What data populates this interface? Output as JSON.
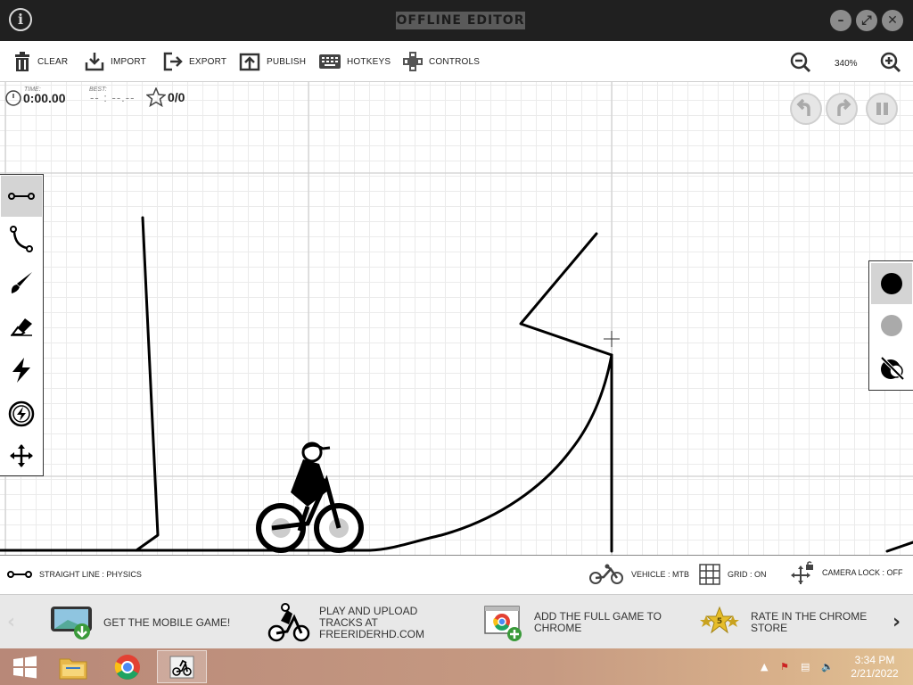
{
  "window": {
    "title": "OFFLINE EDITOR",
    "info_icon": "info-icon",
    "controls": [
      "minimize-icon",
      "maximize-icon",
      "close-icon"
    ]
  },
  "toolbar": {
    "clear": "CLEAR",
    "import": "IMPORT",
    "export": "EXPORT",
    "publish": "PUBLISH",
    "hotkeys": "HOTKEYS",
    "controls": "CONTROLS",
    "zoom": "340%"
  },
  "hud": {
    "time_label": "TIME:",
    "time": "0:00.00",
    "best_label": "BEST:",
    "best": "-- : --.--",
    "stars": "0/0"
  },
  "tools": [
    "straight-line-icon",
    "curve-icon",
    "brush-icon",
    "eraser-icon",
    "powerup-icon",
    "powerup-circle-icon",
    "move-icon"
  ],
  "line_types": [
    "physics-line-icon",
    "scenery-line-icon",
    "toggle-lines-icon"
  ],
  "status": {
    "tool": "STRAIGHT LINE : PHYSICS",
    "vehicle": "VEHICLE : MTB",
    "grid": "GRID : ON",
    "camera": "CAMERA LOCK : OFF"
  },
  "promos": [
    {
      "text": "GET THE MOBILE GAME!"
    },
    {
      "text": "PLAY AND UPLOAD TRACKS AT FREERIDERHD.COM"
    },
    {
      "text": "ADD THE FULL GAME TO CHROME"
    },
    {
      "text": "RATE IN THE CHROME STORE",
      "badge": "5"
    }
  ],
  "taskbar": {
    "time": "3:34 PM",
    "date": "2/21/2022"
  },
  "colors": {
    "titlebar": "#202020",
    "promo_bg": "#e8e8e8",
    "active_tool": "#d4d4d4"
  }
}
